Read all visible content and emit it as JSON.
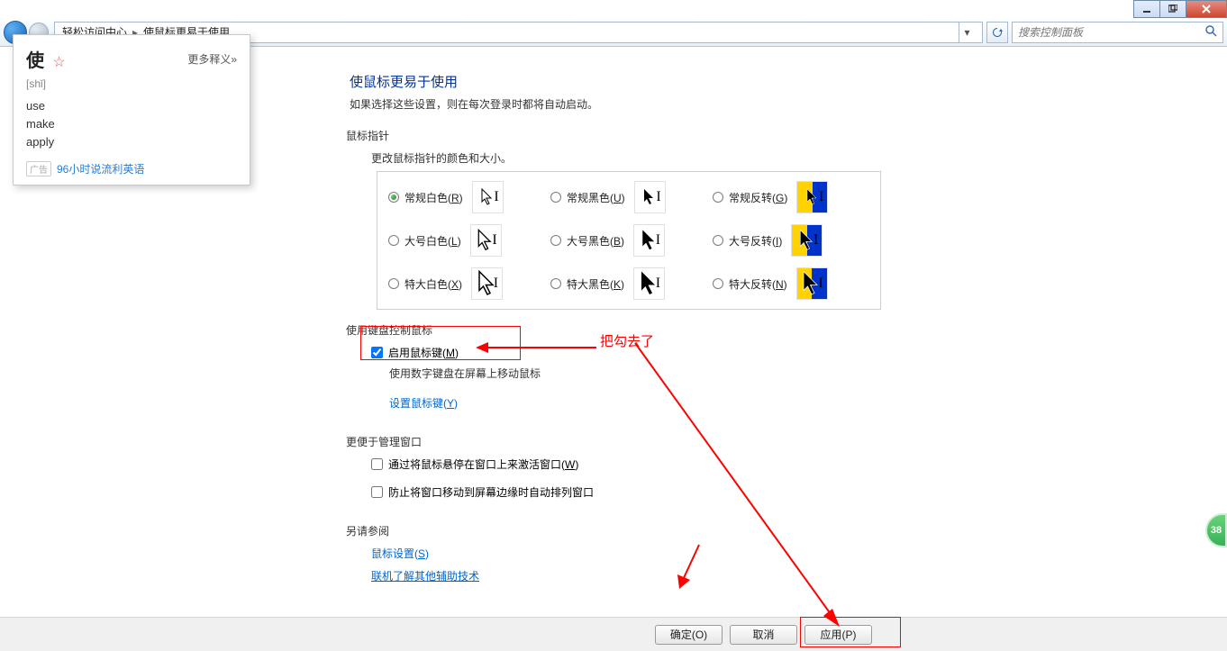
{
  "window": {
    "breadcrumb1": "轻松访问中心",
    "breadcrumb2": "使鼠标更易于使用",
    "search_placeholder": "搜索控制面板"
  },
  "page": {
    "title": "使鼠标更易于使用",
    "subtitle": "如果选择这些设置，则在每次登录时都将自动启动。"
  },
  "sections": {
    "pointer": {
      "group_label": "鼠标指针",
      "subheading": "更改鼠标指针的颜色和大小。",
      "opts": [
        {
          "label": "常规白色(",
          "u": "R",
          "tail": ")"
        },
        {
          "label": "常规黑色(",
          "u": "U",
          "tail": ")"
        },
        {
          "label": "常规反转(",
          "u": "G",
          "tail": ")"
        },
        {
          "label": "大号白色(",
          "u": "L",
          "tail": ")"
        },
        {
          "label": "大号黑色(",
          "u": "B",
          "tail": ")"
        },
        {
          "label": "大号反转(",
          "u": "I",
          "tail": ")"
        },
        {
          "label": "特大白色(",
          "u": "X",
          "tail": ")"
        },
        {
          "label": "特大黑色(",
          "u": "K",
          "tail": ")"
        },
        {
          "label": "特大反转(",
          "u": "N",
          "tail": ")"
        }
      ]
    },
    "keyboard": {
      "group_label": "使用键盘控制鼠标",
      "enable_mousekeys": "启用鼠标键(",
      "enable_u": "M",
      "enable_tail": ")",
      "sub_desc": "使用数字键盘在屏幕上移动鼠标",
      "setup_link": "设置鼠标键(",
      "setup_u": "Y",
      "setup_tail": ")"
    },
    "windows": {
      "group_label": "更便于管理窗口",
      "hover_label": "通过将鼠标悬停在窗口上来激活窗口(",
      "hover_u": "W",
      "hover_tail": ")",
      "snap_label": "防止将窗口移动到屏幕边缘时自动排列窗口"
    },
    "seealso": {
      "group_label": "另请参阅",
      "link1": "鼠标设置(",
      "link1_u": "S",
      "link1_tail": ")",
      "link2": "联机了解其他辅助技术"
    }
  },
  "footer": {
    "ok": "确定(O)",
    "cancel": "取消",
    "apply": "应用(P)"
  },
  "dict": {
    "word": "使",
    "pinyin": "[shǐ]",
    "more": "更多释义»",
    "defs": [
      "use",
      "make",
      "apply"
    ],
    "ad_tag": "广告",
    "ad_text": "96小时说流利英语"
  },
  "annotation": {
    "text": "把勾去了"
  },
  "badge": "38"
}
